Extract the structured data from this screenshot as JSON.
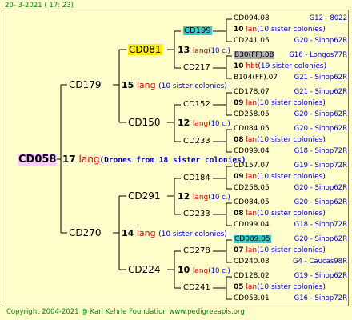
{
  "header": {
    "date": "20-  3-2021 ( 17: 23)"
  },
  "footer": {
    "copyright": "Copyright 2004-2021 @ Karl Kehrle Foundation    www.pedigreeapis.org"
  },
  "root": {
    "id": "CD058",
    "num": "17",
    "lang": "lang",
    "note": "(Drones from 18 sister colonies)"
  },
  "gen1": [
    {
      "id": "CD179",
      "num": "15",
      "lang": "lang",
      "note": "(10 sister colonies)"
    },
    {
      "id": "CD270",
      "num": "14",
      "lang": "lang",
      "note": "(10 sister colonies)"
    }
  ],
  "gen2": [
    {
      "id": "CD081",
      "num": "13",
      "lang": "lang",
      "note": "(10 c.)"
    },
    {
      "id": "CD150",
      "num": "12",
      "lang": "lang",
      "note": "(10 c.)"
    },
    {
      "id": "CD291",
      "num": "12",
      "lang": "lang",
      "note": "(10 c.)"
    },
    {
      "id": "CD224",
      "num": "10",
      "lang": "lang",
      "note": "(10 c.)"
    }
  ],
  "gen3": [
    {
      "id": "CD199"
    },
    {
      "id": "CD217"
    },
    {
      "id": "CD152"
    },
    {
      "id": "CD233"
    },
    {
      "id": "CD184"
    },
    {
      "id": "CD233"
    },
    {
      "id": "CD278"
    },
    {
      "id": "CD241"
    }
  ],
  "gen4": [
    {
      "id": "CD094.08",
      "region": "G12 - 8022"
    },
    {
      "num": "10",
      "lang": "lan",
      "note": "(10 sister colonies)"
    },
    {
      "id": "CD241.05",
      "region": "G20 - Sinop62R"
    },
    {
      "id": "B30(FF).08",
      "region": "G16 - Longos77R"
    },
    {
      "num": "10",
      "lang": "hbt",
      "note": "(19 sister colonies)"
    },
    {
      "id": "B104(FF).07",
      "region": "G21 - Sinop62R"
    },
    {
      "id": "CD178.07",
      "region": "G21 - Sinop62R"
    },
    {
      "num": "09",
      "lang": "lan",
      "note": "(10 sister colonies)"
    },
    {
      "id": "CD258.05",
      "region": "G20 - Sinop62R"
    },
    {
      "id": "CD084.05",
      "region": "G20 - Sinop62R"
    },
    {
      "num": "08",
      "lang": "lan",
      "note": "(10 sister colonies)"
    },
    {
      "id": "CD099.04",
      "region": "G18 - Sinop72R"
    },
    {
      "id": "CD157.07",
      "region": "G19 - Sinop72R"
    },
    {
      "num": "09",
      "lang": "lan",
      "note": "(10 sister colonies)"
    },
    {
      "id": "CD258.05",
      "region": "G20 - Sinop62R"
    },
    {
      "id": "CD084.05",
      "region": "G20 - Sinop62R"
    },
    {
      "num": "08",
      "lang": "lan",
      "note": "(10 sister colonies)"
    },
    {
      "id": "CD099.04",
      "region": "G18 - Sinop72R"
    },
    {
      "id": "CD089.05",
      "region": "G20 - Sinop62R"
    },
    {
      "num": "07",
      "lang": "lan",
      "note": "(10 sister colonies)"
    },
    {
      "id": "CD240.03",
      "region": "G4 - Caucas98R"
    },
    {
      "id": "CD128.02",
      "region": "G19 - Sinop62R"
    },
    {
      "num": "05",
      "lang": "lan",
      "note": "(10 sister colonies)"
    },
    {
      "id": "CD053.01",
      "region": "G16 - Sinop72R"
    }
  ]
}
